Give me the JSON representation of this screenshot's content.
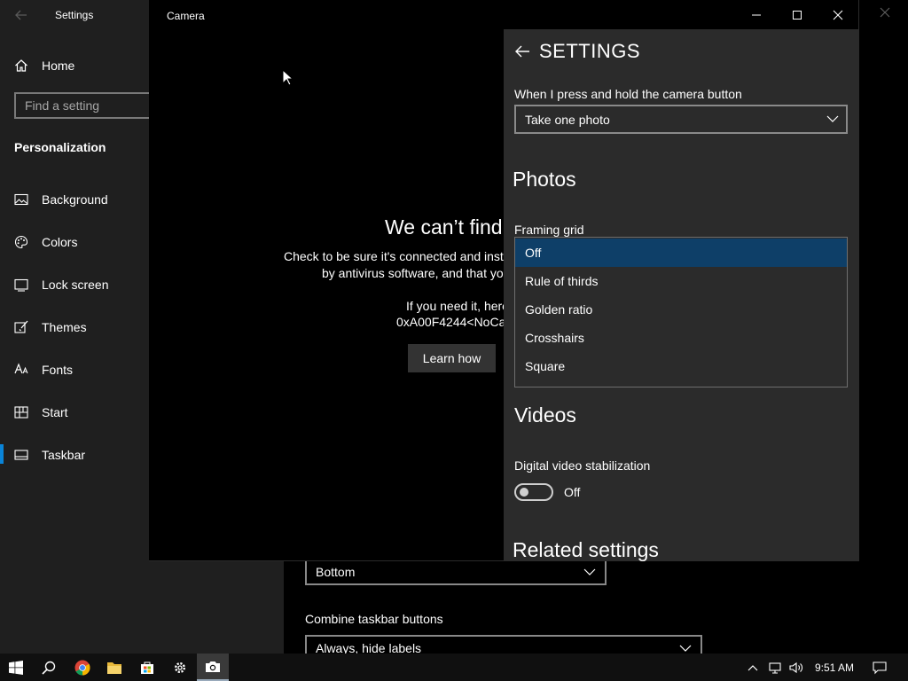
{
  "settings": {
    "title": "Settings",
    "home": "Home",
    "search_placeholder": "Find a setting",
    "section": "Personalization",
    "nav": [
      {
        "label": "Background",
        "icon": "image-icon"
      },
      {
        "label": "Colors",
        "icon": "palette-icon"
      },
      {
        "label": "Lock screen",
        "icon": "lock-screen-icon"
      },
      {
        "label": "Themes",
        "icon": "brush-icon"
      },
      {
        "label": "Fonts",
        "icon": "font-icon"
      },
      {
        "label": "Start",
        "icon": "start-grid-icon"
      },
      {
        "label": "Taskbar",
        "icon": "taskbar-icon",
        "selected": true
      }
    ],
    "taskbar_location_value": "Bottom",
    "combine_label": "Combine taskbar buttons",
    "combine_value": "Always, hide labels"
  },
  "camera": {
    "title": "Camera",
    "error_title": "We can’t find",
    "error_line1": "Check to be sure it's connected and insta",
    "error_line2": "by antivirus software, and that yo",
    "error_line3": "If you need it, here",
    "error_line4": "0xA00F4244<NoCar",
    "learn_how": "Learn how"
  },
  "camera_settings": {
    "header": "SETTINGS",
    "press_hold_label": "When I press and hold the camera button",
    "press_hold_value": "Take one photo",
    "photos_heading": "Photos",
    "framing_label": "Framing grid",
    "framing_options": [
      "Off",
      "Rule of thirds",
      "Golden ratio",
      "Crosshairs",
      "Square"
    ],
    "framing_selected": "Off",
    "videos_heading": "Videos",
    "stabilization_label": "Digital video stabilization",
    "stabilization_state": "Off",
    "related_heading": "Related settings"
  },
  "taskbar": {
    "time": "9:51 AM",
    "accent": "#0e3f68"
  }
}
